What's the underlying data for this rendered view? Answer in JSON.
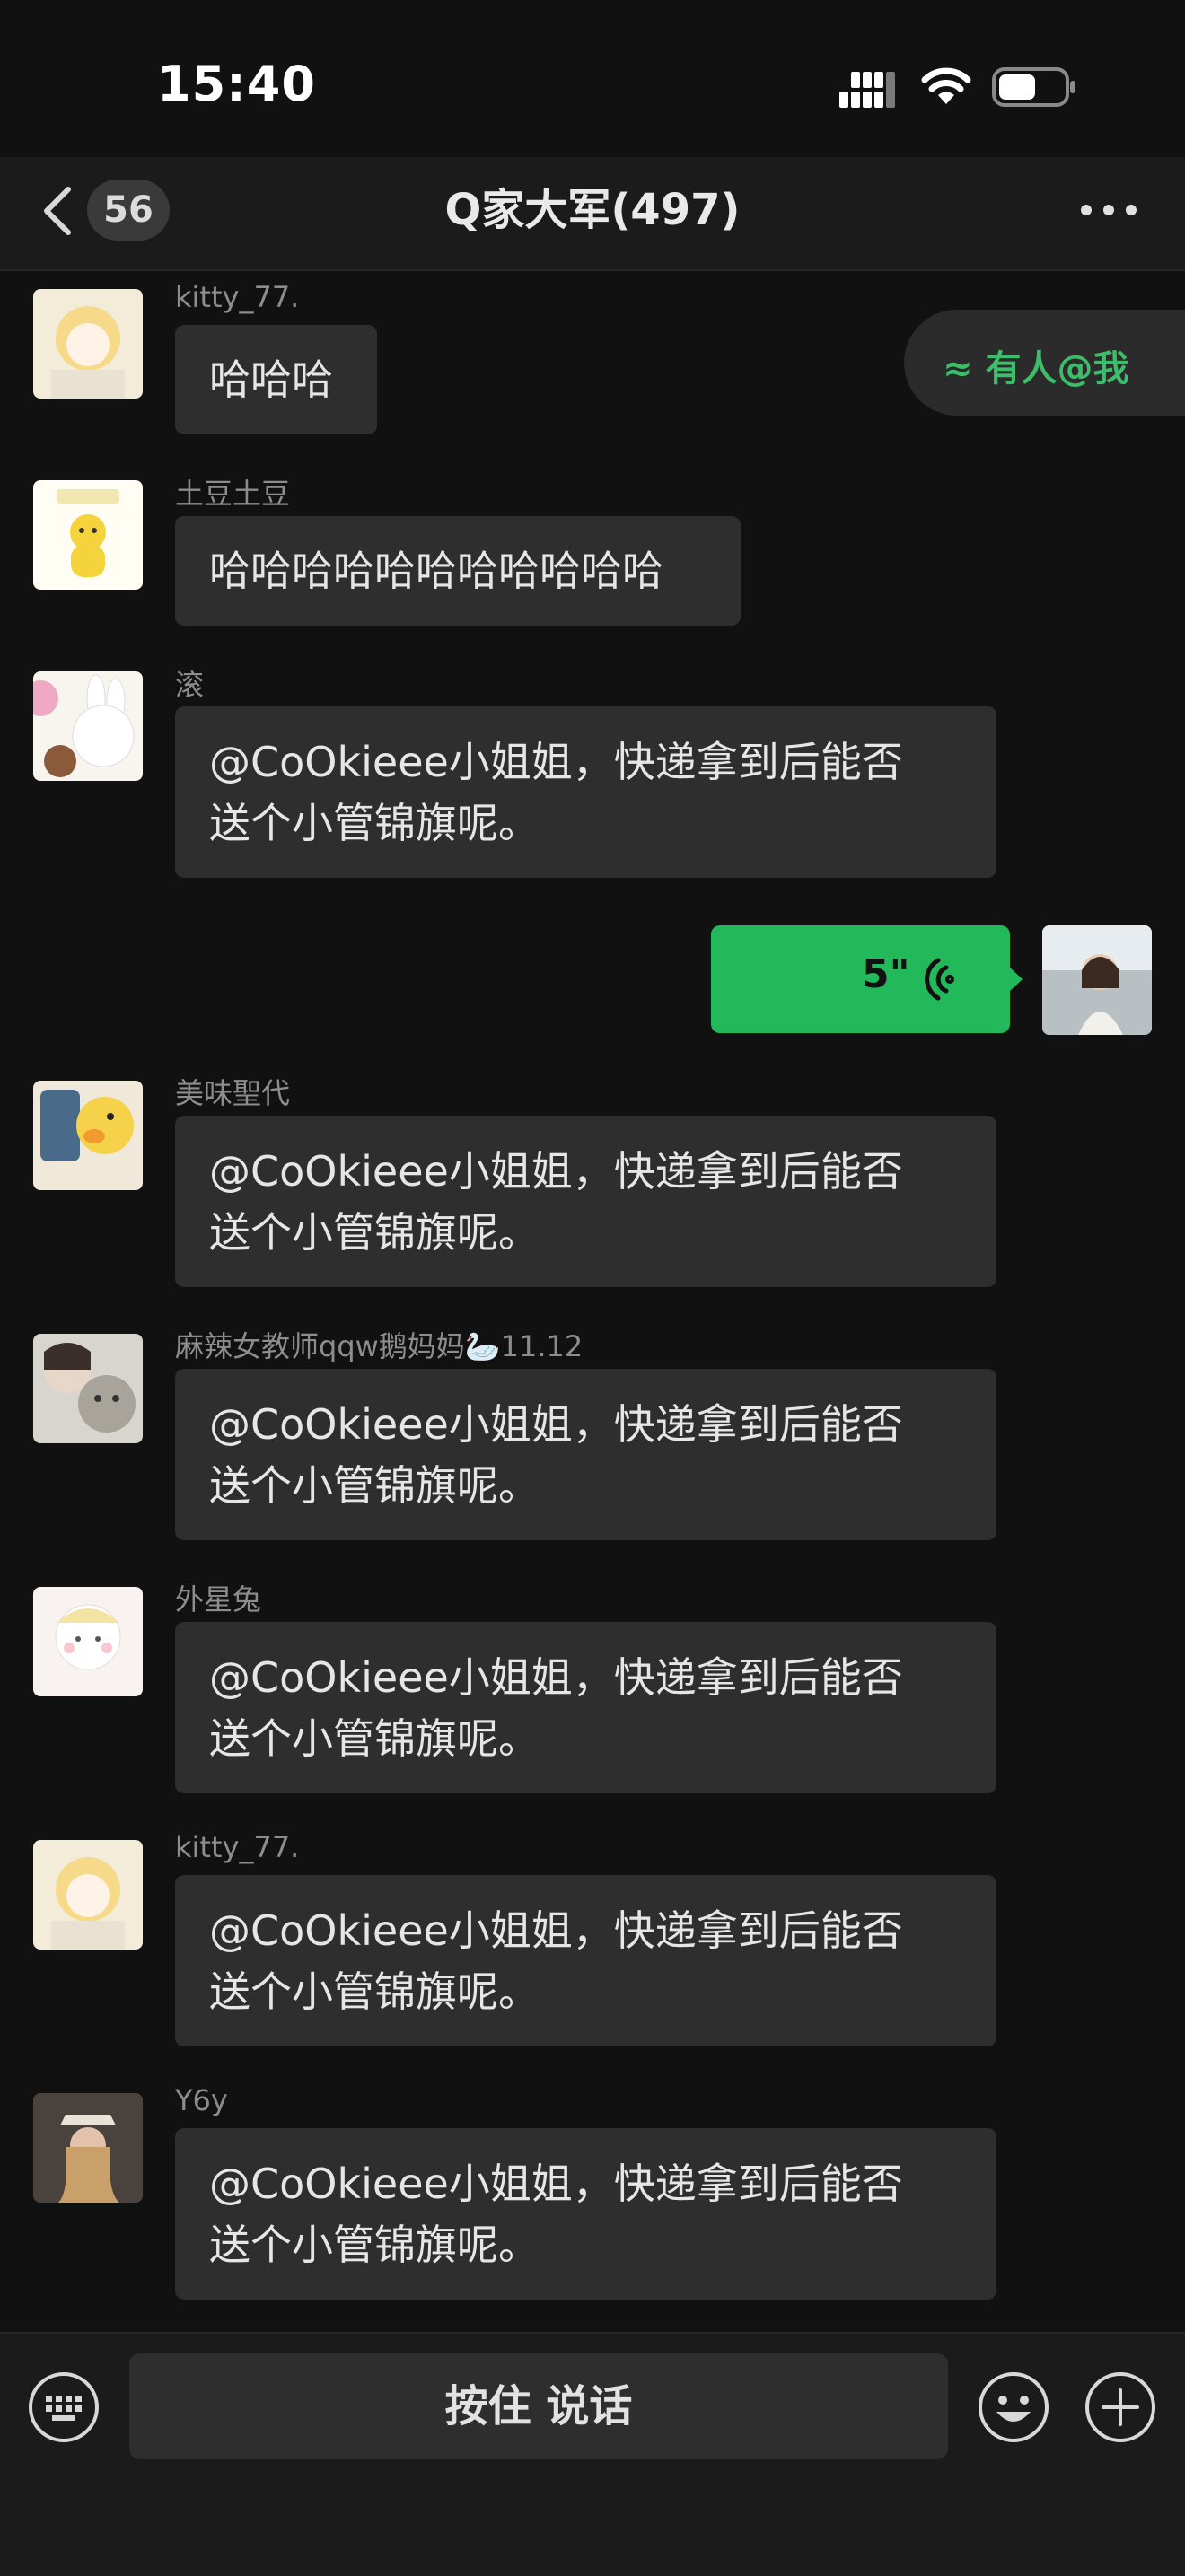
{
  "status_bar": {
    "time": "15:40"
  },
  "header": {
    "back_count": "56",
    "title": "Q家大军(497)"
  },
  "mention_pill": {
    "label": "≈ 有人@我"
  },
  "messages": [
    {
      "sender": "kitty_77.",
      "lines": [
        "哈哈哈"
      ]
    },
    {
      "sender": "土豆土豆",
      "lines": [
        "哈哈哈哈哈哈哈哈哈哈哈"
      ]
    },
    {
      "sender": "滚",
      "lines": [
        "@CoOkieee小姐姐，快递拿到后能否",
        "送个小管锦旗呢。"
      ]
    },
    {
      "sender": "美味聖代",
      "lines": [
        "@CoOkieee小姐姐，快递拿到后能否",
        "送个小管锦旗呢。"
      ]
    },
    {
      "sender": "麻辣女教师qqw鹅妈妈🦢11.12",
      "lines": [
        "@CoOkieee小姐姐，快递拿到后能否",
        "送个小管锦旗呢。"
      ]
    },
    {
      "sender": "外星兔",
      "lines": [
        "@CoOkieee小姐姐，快递拿到后能否",
        "送个小管锦旗呢。"
      ]
    },
    {
      "sender": "kitty_77.",
      "lines": [
        "@CoOkieee小姐姐，快递拿到后能否",
        "送个小管锦旗呢。"
      ]
    },
    {
      "sender": "Y6y",
      "lines": [
        "@CoOkieee小姐姐，快递拿到后能否",
        "送个小管锦旗呢。"
      ]
    }
  ],
  "voice_message": {
    "duration": "5\""
  },
  "bottom_bar": {
    "hold_to_talk": "按住 说话"
  },
  "colors": {
    "accent": "#22b95a",
    "mention_text": "#3dbd6a",
    "background": "#111111",
    "bubble": "#2e2e2e"
  },
  "icons": [
    "signal-icon",
    "wifi-icon",
    "battery-icon",
    "back-chevron-icon",
    "more-icon",
    "keyboard-icon",
    "emoji-icon",
    "plus-icon",
    "voice-wave-icon"
  ]
}
